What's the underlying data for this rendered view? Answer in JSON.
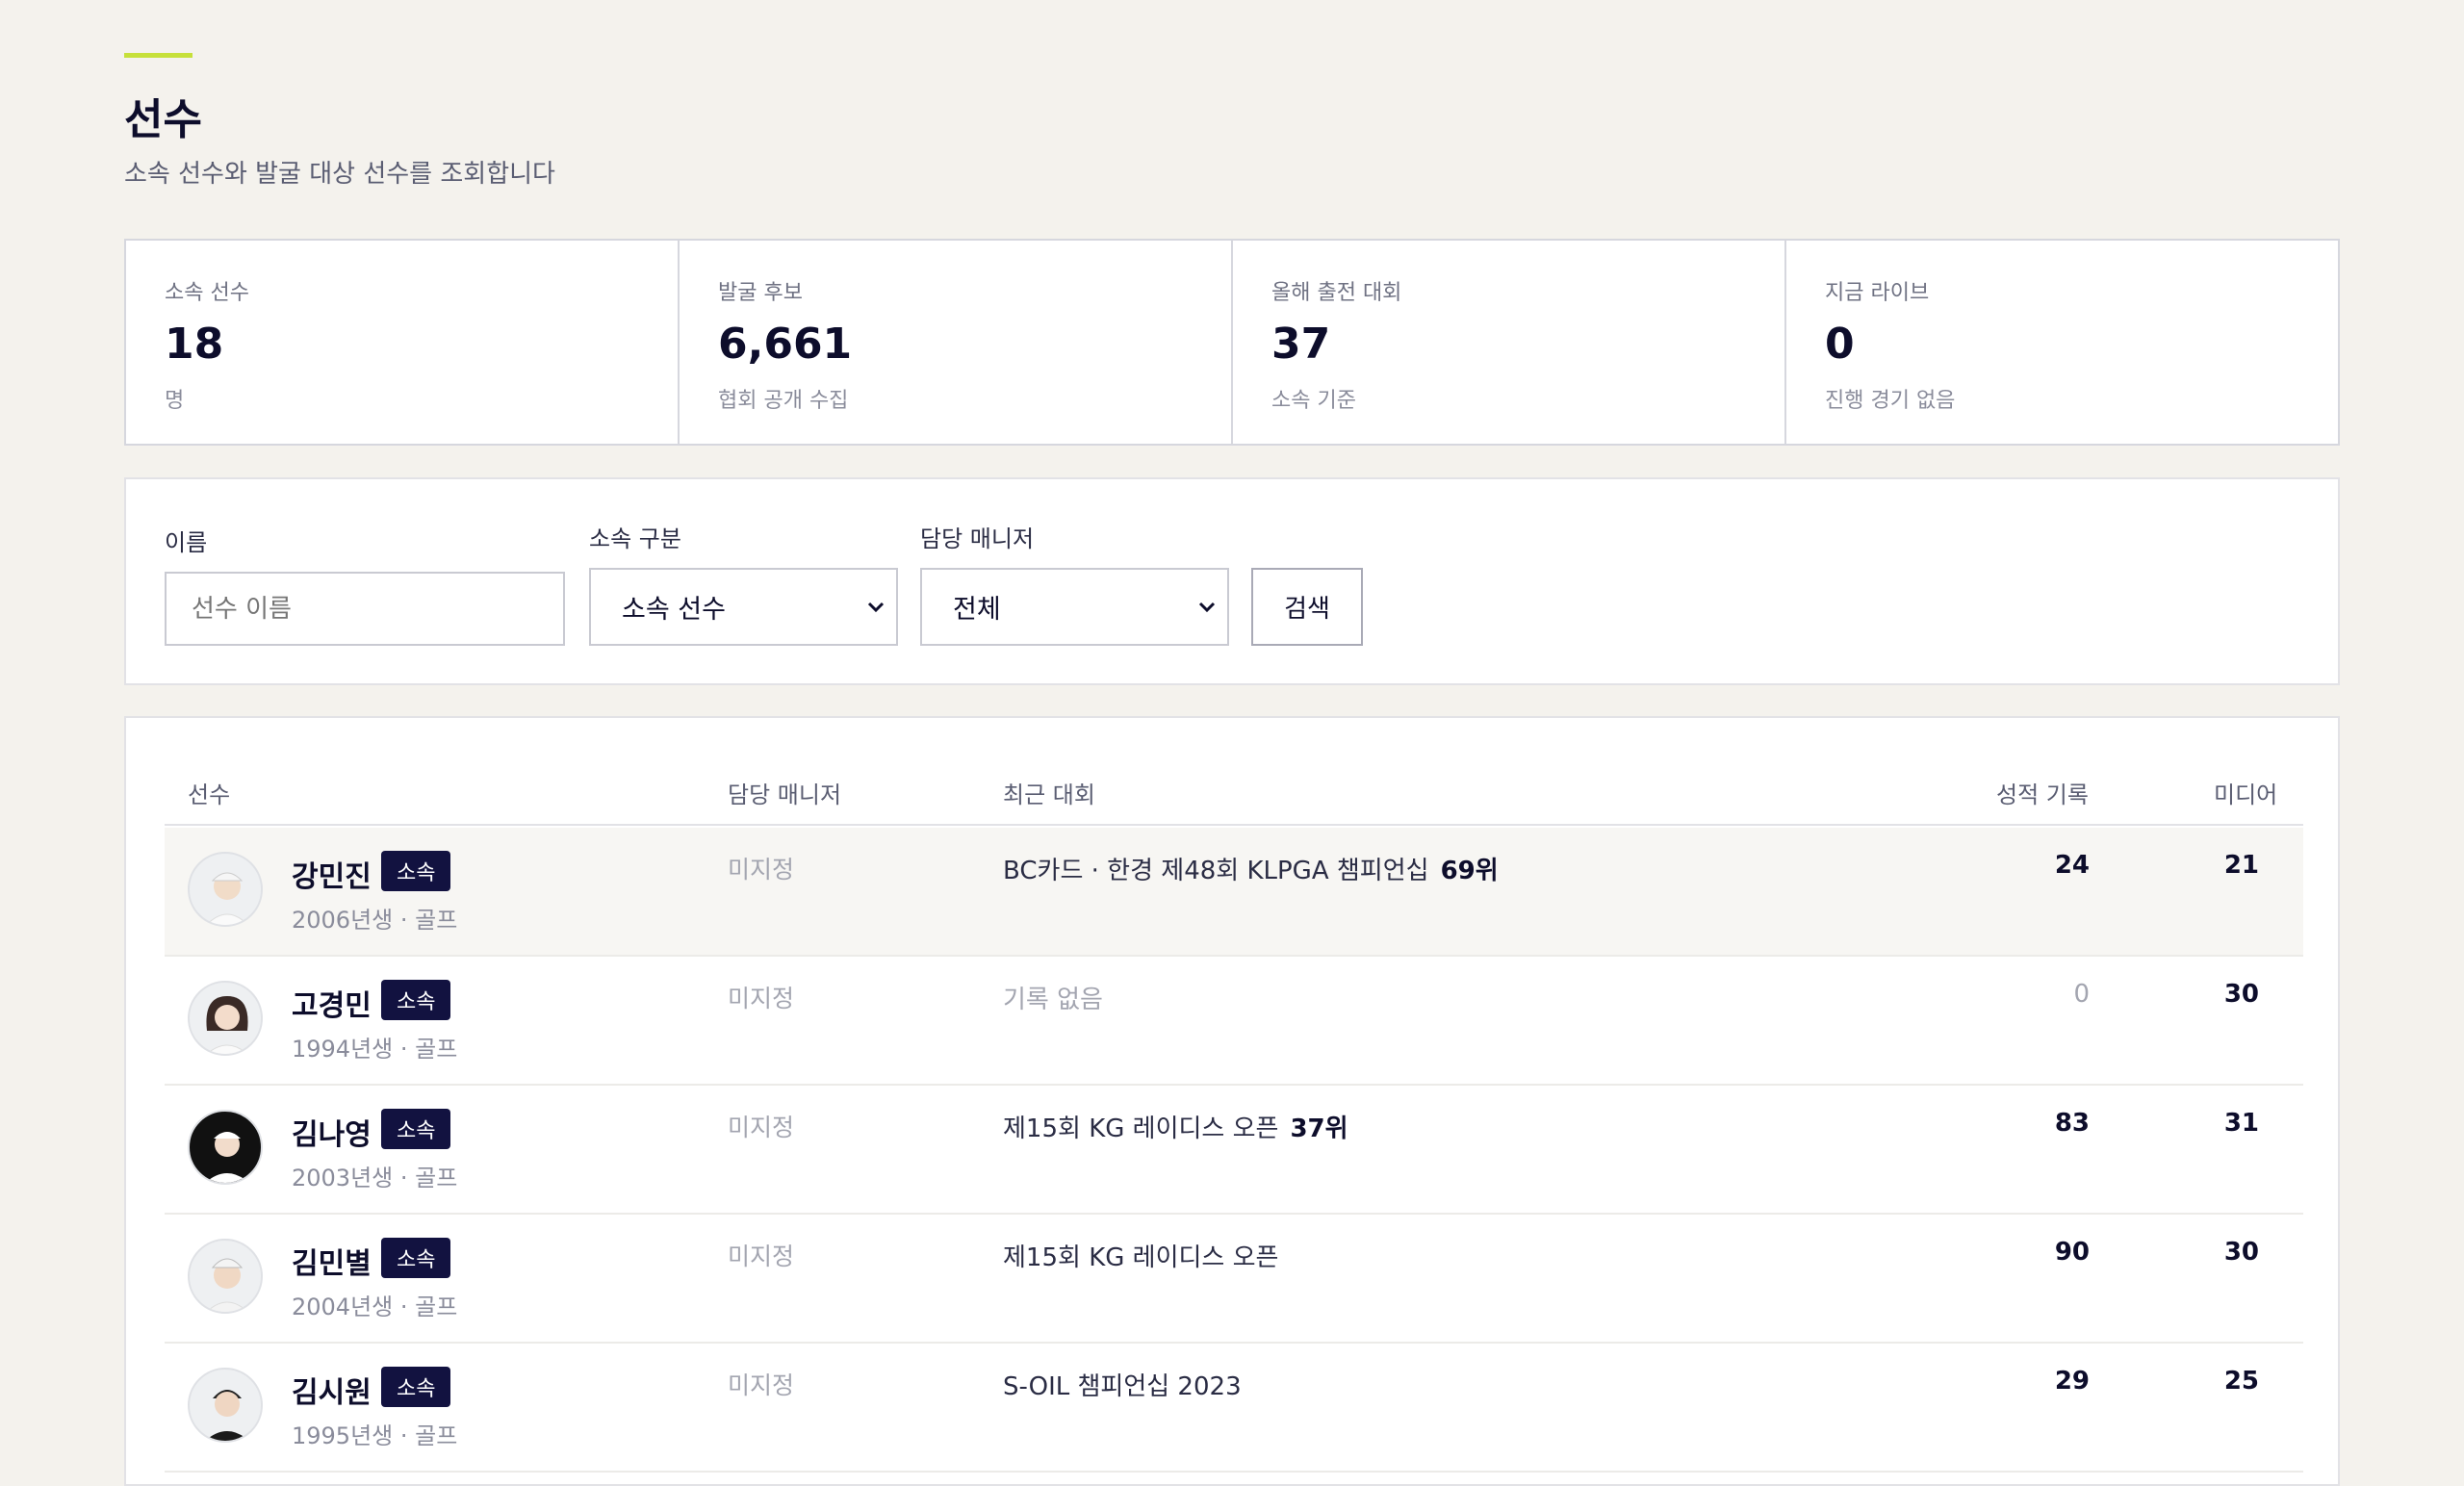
{
  "header": {
    "title": "선수",
    "subtitle": "소속 선수와 발굴 대상 선수를 조회합니다"
  },
  "colors": {
    "accent": "#c6e03a",
    "badge": "#121240"
  },
  "stats": [
    {
      "label": "소속 선수",
      "value": "18",
      "note": "명"
    },
    {
      "label": "발굴 후보",
      "value": "6,661",
      "note": "협회 공개 수집"
    },
    {
      "label": "올해 출전 대회",
      "value": "37",
      "note": "소속 기준"
    },
    {
      "label": "지금 라이브",
      "value": "0",
      "note": "진행 경기 없음"
    }
  ],
  "filters": {
    "name_label": "이름",
    "name_placeholder": "선수 이름",
    "group_label": "소속 구분",
    "group_value": "소속 선수",
    "manager_label": "담당 매니저",
    "manager_value": "전체",
    "search_label": "검색"
  },
  "table": {
    "headers": {
      "player": "선수",
      "manager": "담당 매니저",
      "recent": "최근 대회",
      "records": "성적 기록",
      "media": "미디어"
    },
    "rows": [
      {
        "name": "강민진",
        "badge": "소속",
        "info": "2006년생 · 골프",
        "manager": "미지정",
        "tournament": "BC카드 · 한경 제48회 KLPGA 챔피언십",
        "rank": "69위",
        "records": "24",
        "media": "21"
      },
      {
        "name": "고경민",
        "badge": "소속",
        "info": "1994년생 · 골프",
        "manager": "미지정",
        "tournament": "기록 없음",
        "rank": "",
        "records": "0",
        "media": "30"
      },
      {
        "name": "김나영",
        "badge": "소속",
        "info": "2003년생 · 골프",
        "manager": "미지정",
        "tournament": "제15회 KG 레이디스 오픈",
        "rank": "37위",
        "records": "83",
        "media": "31"
      },
      {
        "name": "김민별",
        "badge": "소속",
        "info": "2004년생 · 골프",
        "manager": "미지정",
        "tournament": "제15회 KG 레이디스 오픈",
        "rank": "",
        "records": "90",
        "media": "30"
      },
      {
        "name": "김시원",
        "badge": "소속",
        "info": "1995년생 · 골프",
        "manager": "미지정",
        "tournament": "S-OIL 챔피언십 2023",
        "rank": "",
        "records": "29",
        "media": "25"
      }
    ]
  }
}
